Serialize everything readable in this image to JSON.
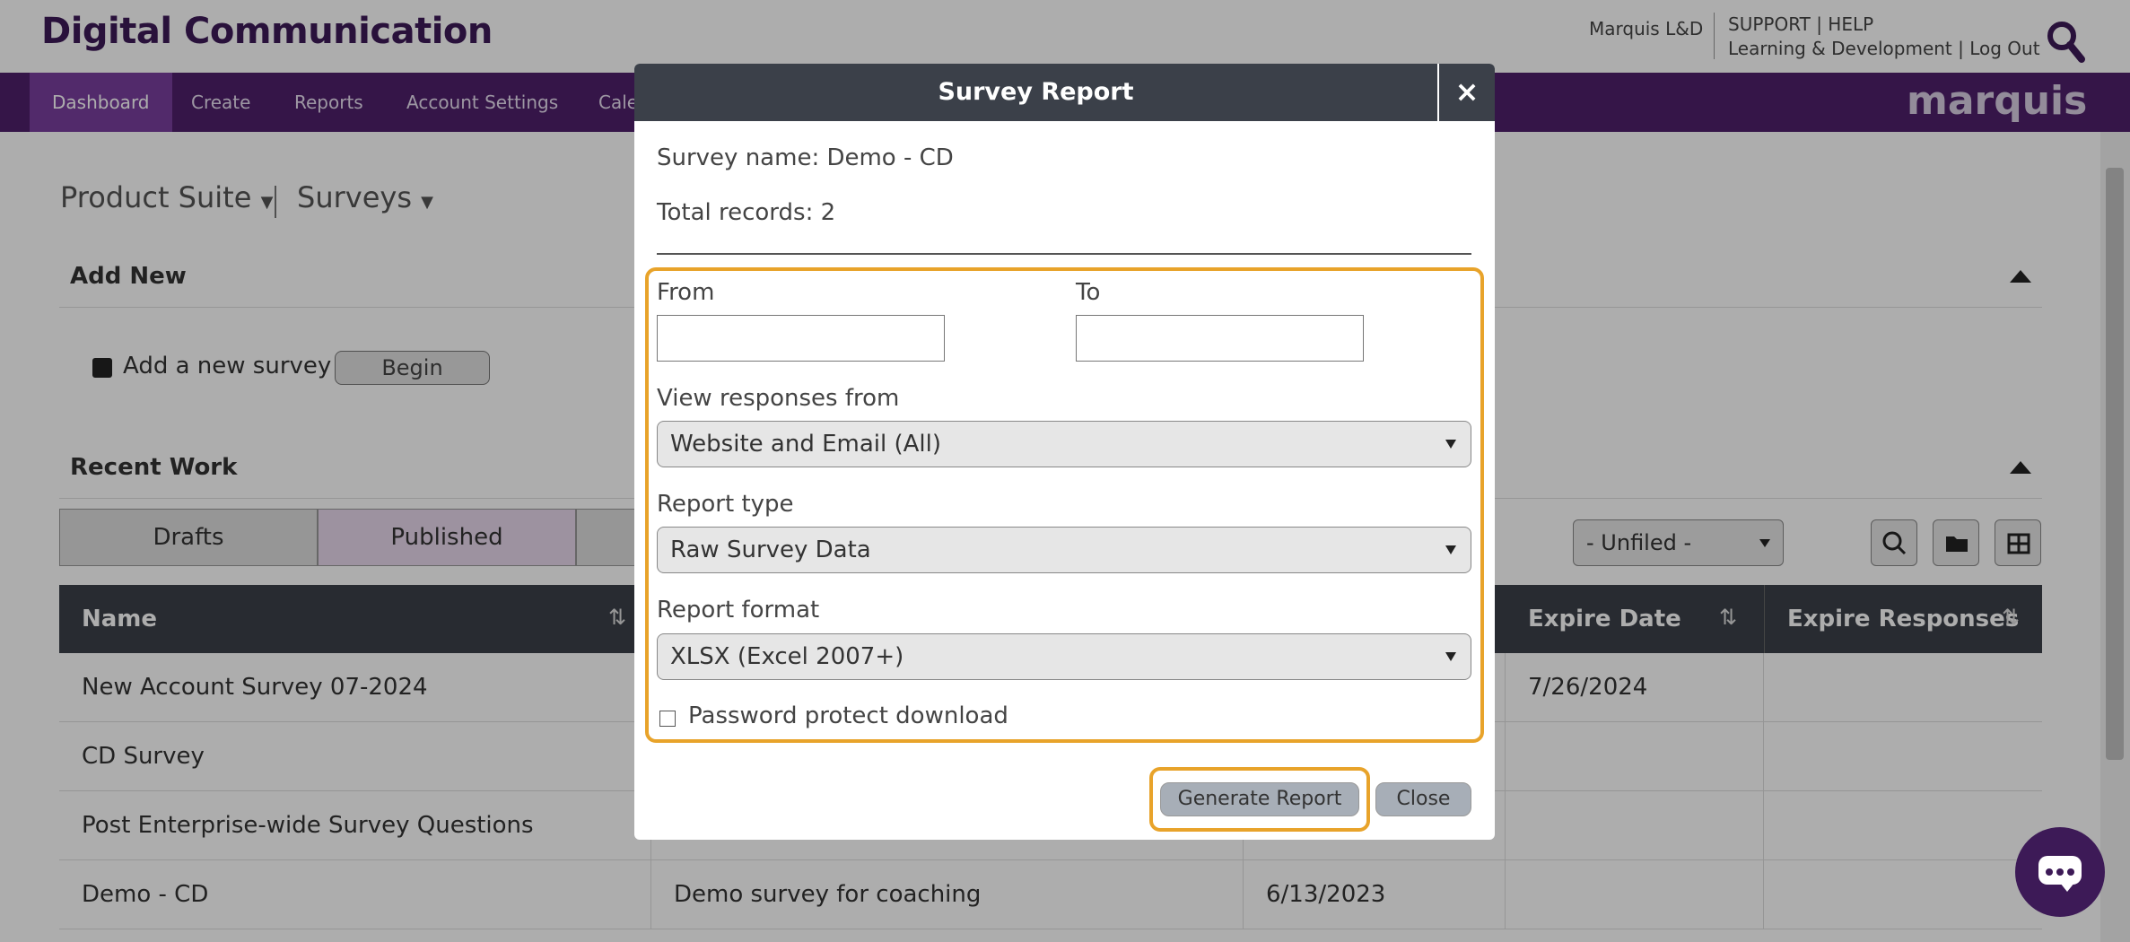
{
  "header": {
    "brand": "Digital Communication",
    "user": "Marquis L&D",
    "links_line1": "SUPPORT | HELP",
    "links_line2": "Learning & Development | Log Out",
    "logo": "marquis"
  },
  "nav": {
    "items": [
      "Dashboard",
      "Create",
      "Reports",
      "Account Settings",
      "Cale"
    ],
    "active": "Dashboard"
  },
  "page": {
    "crumb1": "Product Suite",
    "crumb2": "Surveys",
    "add_new_title": "Add New",
    "add_new_label": "Add a new survey",
    "begin_label": "Begin",
    "recent_title": "Recent Work",
    "tabs": [
      "Drafts",
      "Published"
    ],
    "filter_value": "- Unfiled -"
  },
  "table": {
    "headers": [
      "Name",
      "Expire Date",
      "Expire Responses"
    ],
    "rows": [
      {
        "name": "New Account Survey 07-2024",
        "desc": "",
        "date": "",
        "expire": "7/26/2024"
      },
      {
        "name": "CD Survey",
        "desc": "",
        "date": "",
        "expire": ""
      },
      {
        "name": "Post Enterprise-wide Survey Questions",
        "desc": "",
        "date": "",
        "expire": ""
      },
      {
        "name": "Demo - CD",
        "desc": "Demo survey for coaching",
        "date": "6/13/2023",
        "expire": ""
      }
    ]
  },
  "modal": {
    "title": "Survey Report",
    "close_symbol": "×",
    "survey_name": "Survey name: Demo - CD",
    "total_records": "Total records: 2",
    "from_label": "From",
    "to_label": "To",
    "from_value": "",
    "to_value": "",
    "view_label": "View responses from",
    "view_value": "Website and Email (All)",
    "type_label": "Report type",
    "type_value": "Raw Survey Data",
    "format_label": "Report format",
    "format_value": "XLSX (Excel 2007+)",
    "password_label": "Password protect download",
    "password_checked": false,
    "generate_label": "Generate Report",
    "close_label": "Close"
  },
  "colors": {
    "brand": "#3d1a57",
    "nav": "#4e1f6b",
    "highlight": "#e8a32a",
    "header_dark": "#3b4049"
  }
}
